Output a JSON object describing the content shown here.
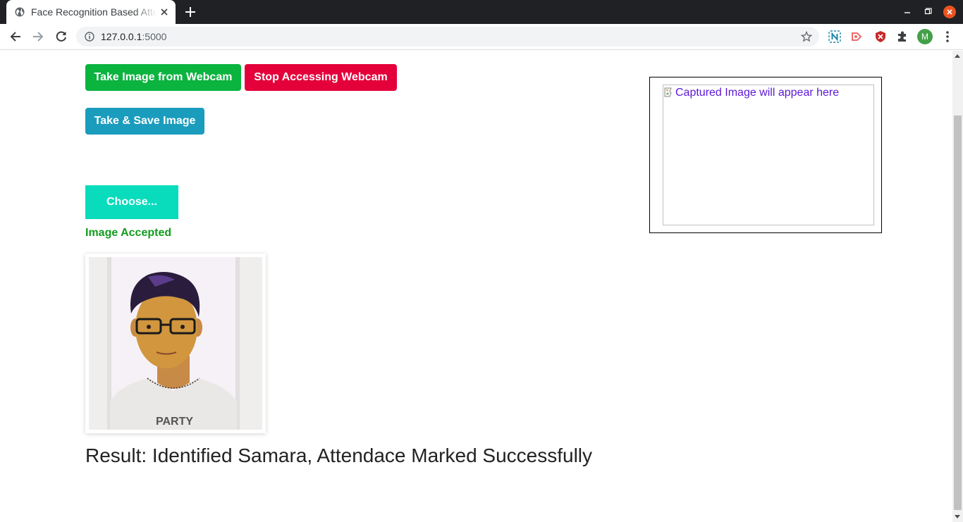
{
  "browser": {
    "tab_title": "Face Recognition Based Attendance",
    "url_host": "127.0.0.1",
    "url_port": ":5000",
    "avatar_letter": "M"
  },
  "page": {
    "buttons": {
      "take_webcam": "Take Image from Webcam",
      "stop_webcam": "Stop Accessing Webcam",
      "take_save": "Take & Save Image",
      "choose": "Choose..."
    },
    "status": "Image Accepted",
    "result": "Result: Identified Samara, Attendace Marked Successfully",
    "captured_alt": "Captured Image will appear here"
  },
  "colors": {
    "take_webcam": "#0bb33f",
    "stop_webcam": "#e4003a",
    "take_save": "#1a9cbd",
    "choose": "#08dcbc",
    "accepted_text": "#139b1e",
    "alt_link": "#5b17d6"
  },
  "icons": [
    "globe-icon",
    "close-icon",
    "plus-icon",
    "back-icon",
    "forward-icon",
    "reload-icon",
    "info-icon",
    "star-icon",
    "extension-n-icon",
    "extension-cast-icon",
    "shield-icon",
    "puzzle-icon",
    "menu-icon",
    "broken-image-icon"
  ]
}
